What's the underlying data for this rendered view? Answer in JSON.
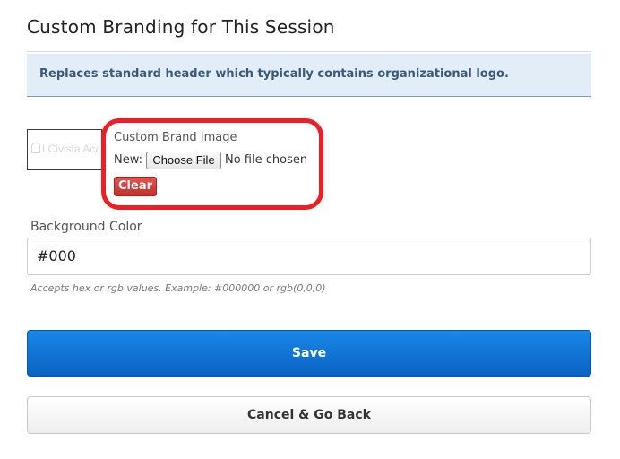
{
  "page": {
    "title": "Custom Branding for This Session"
  },
  "info_banner": {
    "text": "Replaces standard header which typically contains organizational logo."
  },
  "brand_image": {
    "thumbnail_logo_text": "LCivista Academ",
    "label": "Custom Brand Image",
    "new_label": "New:",
    "choose_file_label": "Choose File",
    "file_status": "No file chosen",
    "clear_label": "Clear"
  },
  "background_color": {
    "label": "Background Color",
    "value": "#000",
    "hint": "Accepts hex or rgb values. Example: #000000 or rgb(0,0,0)"
  },
  "actions": {
    "save_label": "Save",
    "cancel_label": "Cancel & Go Back"
  },
  "colors": {
    "highlight_ring": "#ef1d24",
    "save_button": "#0a6fd6",
    "clear_button": "#d2403a",
    "info_banner_bg": "#e3edf8",
    "info_banner_text": "#3b5a78"
  }
}
